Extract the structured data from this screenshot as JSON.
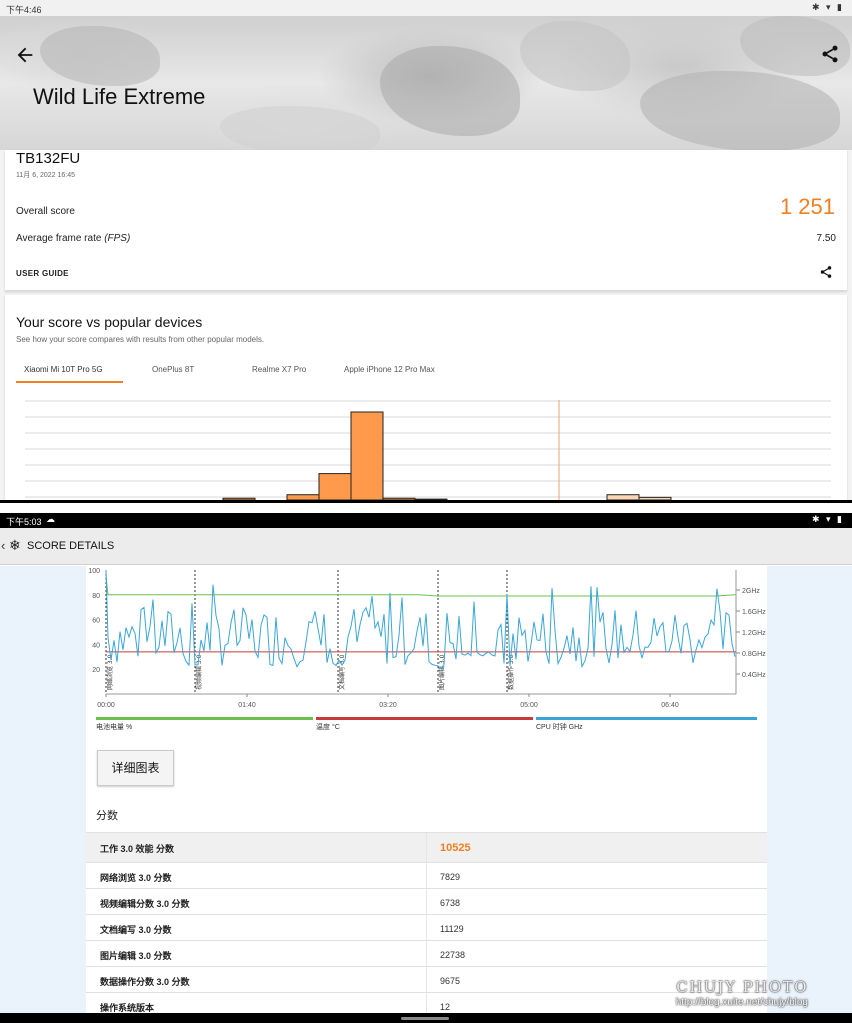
{
  "top": {
    "status": {
      "time": "下午4:46",
      "icons": "✱ ▾ ▮"
    },
    "hero_title": "Wild Life Extreme",
    "device": {
      "name": "TB132FU",
      "date": "11月 6, 2022 16:45"
    },
    "overall": {
      "label": "Overall score",
      "value": "1 251"
    },
    "fps": {
      "label": "Average frame rate ",
      "unit": "(FPS)",
      "value": "7.50"
    },
    "user_guide": "USER GUIDE",
    "compare": {
      "title": "Your score vs popular devices",
      "subtitle": "See how your score compares with results from other popular models.",
      "tabs": [
        "Xiaomi Mi 10T Pro 5G",
        "OnePlus 8T",
        "Realme X7 Pro",
        "Apple iPhone 12 Pro Max"
      ],
      "active_tab": 0
    },
    "histogram": {
      "bins": [
        0,
        0,
        0,
        0,
        0,
        0,
        0,
        0,
        0.02,
        0,
        0.06,
        0.3,
        1.0,
        0.02,
        0.01,
        0,
        0,
        0,
        0,
        0,
        0.06,
        0.03,
        0,
        0,
        0
      ],
      "colors": {
        "bar": "#ff9a4d",
        "bar_light": "#fcd6b2",
        "marker": "#f0a070"
      }
    },
    "accent": "#f07f22"
  },
  "bottom": {
    "status": {
      "time": "下午5:03",
      "cloud": "☁",
      "icons": "✱ ▾ ▮"
    },
    "app_title": "SCORE DETAILS",
    "chart": {
      "y_left": [
        "100",
        "80",
        "60",
        "40",
        "20"
      ],
      "y_right": [
        "2GHz",
        "1.6GHz",
        "1.2GHz",
        "0.8GHz",
        "0.4GHz"
      ],
      "x_ticks": [
        "00:00",
        "01:40",
        "03:20",
        "05:00",
        "06:40"
      ],
      "segments": [
        "网络浏览 3.0",
        "视频编辑 3.0",
        "文档编写 3.0",
        "图片编辑 3.0",
        "数据操作 3.0"
      ],
      "battery_pct": [
        80,
        80,
        80,
        80,
        79,
        79
      ],
      "temp_c": 34,
      "colors": {
        "battery": "#6cc04a",
        "temp": "#c43b3b",
        "cpu": "#3aa6d8"
      }
    },
    "legend": [
      {
        "label": "电池电量 %",
        "color": "#6cc04a"
      },
      {
        "label": "温度 °C",
        "color": "#c43b3b"
      },
      {
        "label": "CPU 时钟 GHz",
        "color": "#3aa6d8"
      }
    ],
    "detail_button": "详细图表",
    "section_title": "分数",
    "scores": [
      {
        "name": "工作 3.0 效能 分数",
        "value": "10525"
      },
      {
        "name": "网络浏览 3.0 分数",
        "value": "7829"
      },
      {
        "name": "视频编辑分数 3.0 分数",
        "value": "6738"
      },
      {
        "name": "文档编写 3.0 分数",
        "value": "11129"
      },
      {
        "name": "图片编辑 3.0 分数",
        "value": "22738"
      },
      {
        "name": "数据操作分数 3.0 分数",
        "value": "9675"
      },
      {
        "name": "操作系统版本",
        "value": "12"
      }
    ],
    "watermark": {
      "line1": "CHUJY PHOTO",
      "line2": "http://blog.xuite.net/chujy/blog"
    }
  }
}
